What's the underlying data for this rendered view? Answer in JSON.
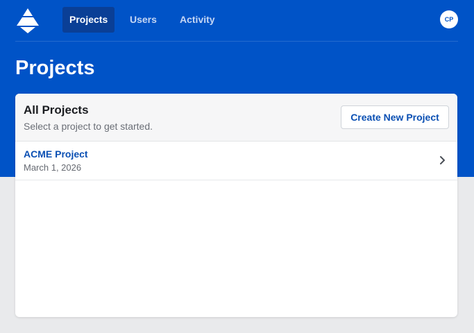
{
  "nav": {
    "logo_icon": "triangle-logo-icon",
    "links": [
      {
        "label": "Projects",
        "active": true
      },
      {
        "label": "Users",
        "active": false
      },
      {
        "label": "Activity",
        "active": false
      }
    ],
    "avatar_initials": "CP"
  },
  "page": {
    "title": "Projects"
  },
  "card": {
    "title": "All Projects",
    "subtitle": "Select a project to get started.",
    "create_button_label": "Create New Project"
  },
  "projects": [
    {
      "name": "ACME Project",
      "date": "March 1, 2026",
      "icon": "chevron-right-icon"
    }
  ],
  "colors": {
    "brand": "#0053c7",
    "active_nav": "#0a3f96",
    "link": "#0a4fb3",
    "page_background": "#e9eaec"
  }
}
